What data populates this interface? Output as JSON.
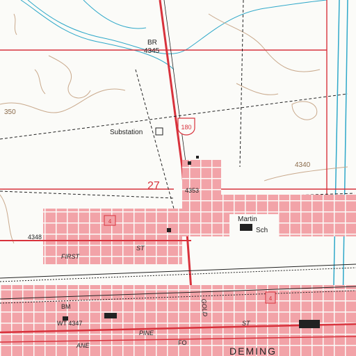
{
  "map": {
    "labels": {
      "br_label": "BR",
      "br_elev": "4345",
      "contour_350": "350",
      "substation": "Substation",
      "route_180": "180",
      "section_27": "27",
      "elev_4353": "4353",
      "elev_4340": "4340",
      "elev_4348": "4348",
      "route_4": "4",
      "martin": "Martin",
      "sch": "Sch",
      "first_st": "FIRST",
      "st_label": "ST",
      "gold": "GOLD",
      "bm": "BM",
      "wt_elev": "WT 4347",
      "route_4b": "4",
      "st2": "ST",
      "pine": "PINE",
      "deming": "DEMING",
      "ane": "ANE",
      "fo": "FO"
    },
    "colors": {
      "urban_fill": "#f2a3a8",
      "red_line": "#d8323c",
      "contour": "#c9a98c",
      "water": "#2fa8c9",
      "road_gray": "#9a9a9a",
      "black": "#222222"
    }
  }
}
